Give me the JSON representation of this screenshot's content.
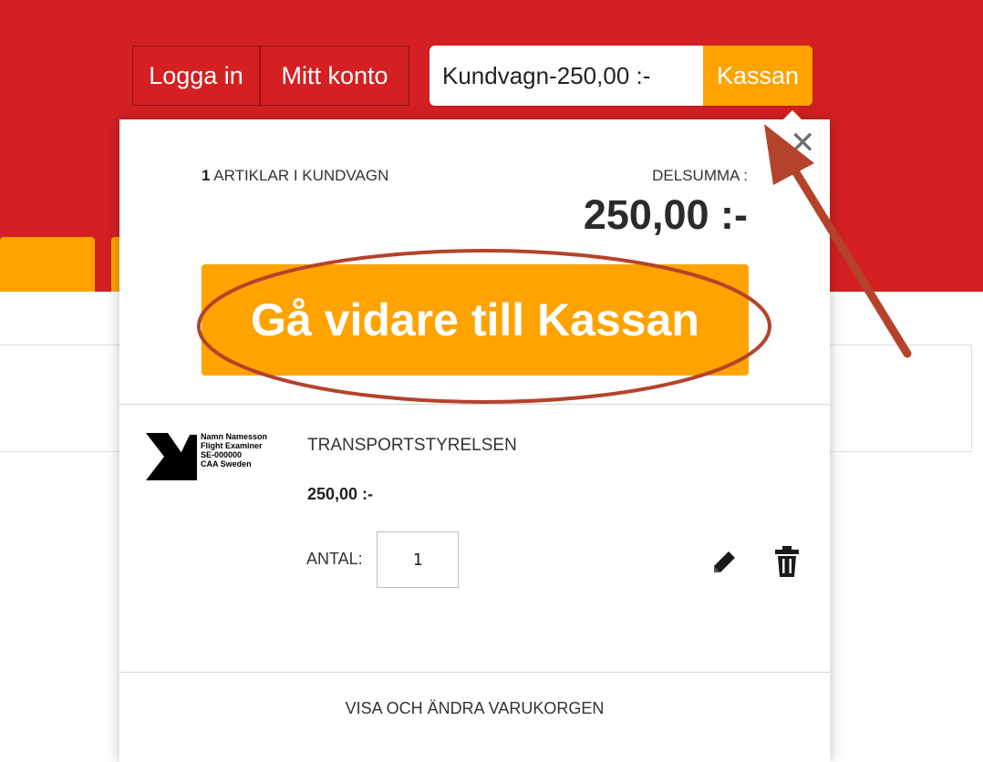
{
  "colors": {
    "brand_red": "#d42022",
    "accent_orange": "#ffa300",
    "annotation_red": "#b5432b"
  },
  "header": {
    "login_label": "Logga in",
    "account_label": "Mitt konto",
    "cart_summary": "Kundvagn-250,00 :-",
    "checkout_label": "Kassan"
  },
  "cart_dropdown": {
    "item_count": "1",
    "item_count_text": "ARTIKLAR I KUNDVAGN",
    "subtotal_label": "DELSUMMA :",
    "subtotal_value": "250,00 :-",
    "proceed_button": "Gå vidare till Kassan",
    "close_icon": "close-icon",
    "item": {
      "name": "TRANSPORTSTYRELSEN",
      "price": "250,00 :-",
      "qty_label": "ANTAL:",
      "qty_value": "1",
      "thumb_lines": [
        "Namn Namesson",
        "Flight Examiner",
        "SE-000000",
        "CAA Sweden"
      ],
      "edit_icon": "pencil-icon",
      "delete_icon": "trash-icon"
    },
    "footer_link": "VISA OCH ÄNDRA VARUKORGEN"
  }
}
